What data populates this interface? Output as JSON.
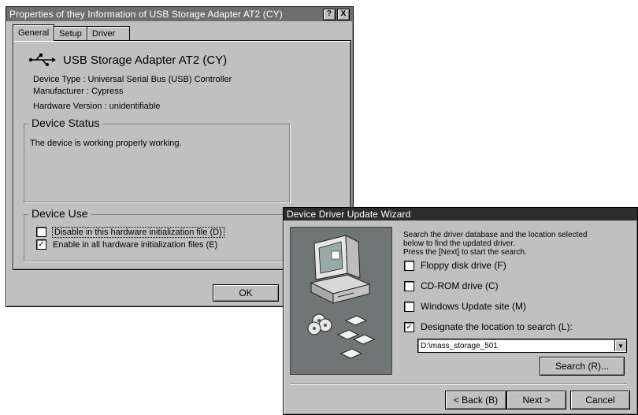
{
  "properties": {
    "title": "Properties of they Information of USB Storage Adapter AT2 (CY)",
    "help_label": "?",
    "close_label": "X",
    "tabs": [
      {
        "label": "General"
      },
      {
        "label": "Setup"
      },
      {
        "label": "Driver"
      }
    ],
    "device_name": "USB Storage Adapter AT2 (CY)",
    "device_type": "Device Type : Universal Serial Bus (USB) Controller",
    "manufacturer": "Manufacturer : Cypress",
    "hardware_version": "Hardware Version : unidentifiable",
    "status_legend": "Device Status",
    "status_text": "The device is working properly working.",
    "use_legend": "Device Use",
    "use_options": [
      {
        "label": "Disable in this hardware initialization file (D)",
        "checked": false,
        "mark": ""
      },
      {
        "label": "Enable in all hardware initialization files (E)",
        "checked": true,
        "mark": "✓"
      }
    ],
    "ok_label": "OK",
    "icon": "usb-icon"
  },
  "wizard": {
    "title": "Device Driver Update Wizard",
    "intro_lines": [
      "Search the driver database and the location selected",
      "below to find the updated driver.",
      "Press the [Next] to start the search."
    ],
    "options": [
      {
        "label": "Floppy disk drive (F)",
        "checked": false,
        "mark": ""
      },
      {
        "label": "CD-ROM drive (C)",
        "checked": false,
        "mark": ""
      },
      {
        "label": "Windows Update site (M)",
        "checked": false,
        "mark": ""
      },
      {
        "label": "Designate the location to search (L):",
        "checked": true,
        "mark": "✓"
      }
    ],
    "location_value": "D:\\mass_storage_501",
    "search_label": "Search (R)...",
    "back_label": "< Back (B)",
    "next_label": "Next >",
    "cancel_label": "Cancel",
    "illustration": "computer-with-discs-icon"
  }
}
